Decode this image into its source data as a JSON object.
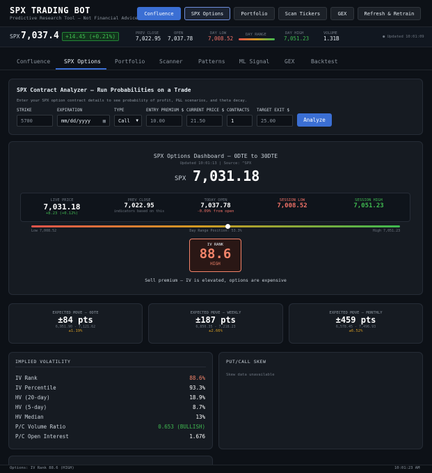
{
  "app": {
    "title": "SPX TRADING BOT",
    "subtitle": "Predictive Research Tool — Not Financial Advice"
  },
  "header_buttons": [
    "Confluence",
    "SPX Options",
    "Portfolio",
    "Scan Tickers",
    "GEX",
    "Refresh & Retrain"
  ],
  "ticker": {
    "symbol": "SPX",
    "price": "7,037.4",
    "change": "+14.45 (+0.21%)",
    "prev_close_label": "PREV CLOSE",
    "prev_close": "7,022.95",
    "open_label": "OPEN",
    "open": "7,037.78",
    "day_low_label": "DAY LOW",
    "day_low": "7,008.52",
    "day_range_label": "DAY RANGE",
    "day_high_label": "DAY HIGH",
    "day_high": "7,051.23",
    "volume_label": "VOLUME",
    "volume": "1.31B",
    "updated": "● Updated 10:01:09"
  },
  "tabs": [
    "Confluence",
    "SPX Options",
    "Portfolio",
    "Scanner",
    "Patterns",
    "ML Signal",
    "GEX",
    "Backtest"
  ],
  "analyzer": {
    "title": "SPX Contract Analyzer — Run Probabilities on a Trade",
    "desc": "Enter your SPX option contract details to see probability of profit, P&L scenarios, and theta decay.",
    "strike_label": "STRIKE",
    "strike_placeholder": "5700",
    "expiration_label": "EXPIRATION",
    "expiration_placeholder": "mm/dd/yyyy",
    "type_label": "TYPE",
    "type_value": "Call",
    "entry_label": "ENTRY PREMIUM $",
    "entry_placeholder": "10.00",
    "current_label": "CURRENT PRICE $",
    "current_placeholder": "21.50",
    "contracts_label": "CONTRACTS",
    "contracts_value": "1",
    "target_label": "TARGET EXIT $",
    "target_placeholder": "25.00",
    "analyze_label": "Analyze"
  },
  "dashboard": {
    "title": "SPX Options Dashboard — 0DTE to 30DTE",
    "updated": "Updated 10:01:13 | Source: ^SPX",
    "symbol": "SPX",
    "price": "7,031.18",
    "live_label": "LIVE PRICE",
    "live_value": "7,031.18",
    "live_change": "+8.23 (+0.12%)",
    "prev_label": "PREV CLOSE",
    "prev_value": "7,022.95",
    "prev_note": "indicators based on this",
    "open_label": "TODAY OPEN",
    "open_value": "7,037.78",
    "open_note": "-0.09% from open",
    "low_label": "SESSION LOW",
    "low_value": "7,008.52",
    "high_label": "SESSION HIGH",
    "high_value": "7,051.23",
    "range_low": "Low 7,008.52",
    "range_pos": "Day Range Position: 53.3%",
    "range_high": "High 7,051.23",
    "range_position": 0.533,
    "iv_label": "IV RANK",
    "iv_value": "88.6",
    "iv_level": "HIGH",
    "iv_note": "Sell premium — IV is elevated, options are expensive"
  },
  "moves": [
    {
      "label": "EXPECTED MOVE — 0DTE",
      "value": "±84 pts",
      "range": "6,951.90 - 7,121.62",
      "pct": "±1.19%"
    },
    {
      "label": "EXPECTED MOVE — WEEKLY",
      "value": "±187 pts",
      "range": "6,850.35 - 7,218.23",
      "pct": "±2.66%"
    },
    {
      "label": "EXPECTED MOVE — MONTHLY",
      "value": "±459 pts",
      "range": "6,578.45 - 7,496.93",
      "pct": "±6.52%"
    }
  ],
  "iv_panel": {
    "title": "IMPLIED VOLATILITY",
    "rows": [
      {
        "k": "IV Rank",
        "v": "88.6%"
      },
      {
        "k": "IV Percentile",
        "v": "93.3%"
      },
      {
        "k": "HV (20-day)",
        "v": "18.9%"
      },
      {
        "k": "HV (5-day)",
        "v": "8.7%"
      },
      {
        "k": "HV Median",
        "v": "13%"
      },
      {
        "k": "P/C Volume Ratio",
        "v": "0.653 (BULLISH)"
      },
      {
        "k": "P/C Open Interest",
        "v": "1.676"
      }
    ]
  },
  "skew": {
    "title": "PUT/CALL SKEW",
    "empty": "Skew data unavailable"
  },
  "footer": {
    "left": "Options: IV Rank 88.6 (HIGH)",
    "right": "10:01:23 AM"
  },
  "colors": {
    "accent": "#3b6fd4",
    "green": "#3fb950",
    "red": "#f07167",
    "iv": "#f4846a"
  }
}
